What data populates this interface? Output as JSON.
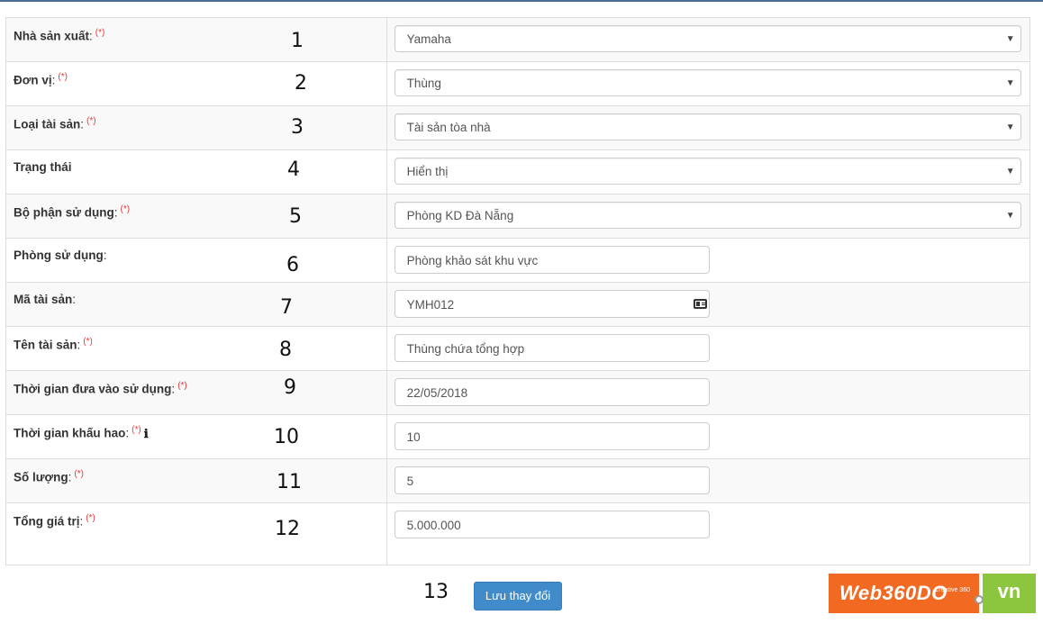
{
  "required_marker": "(*)",
  "fields": [
    {
      "label": "Nhà sản xuất",
      "colon": ":",
      "required": true,
      "number": "1",
      "type": "select",
      "value": "Yamaha"
    },
    {
      "label": "Đơn vị",
      "colon": ":",
      "required": true,
      "number": "2",
      "type": "select",
      "value": "Thùng"
    },
    {
      "label": "Loại tài sản",
      "colon": ":",
      "required": true,
      "number": "3",
      "type": "select",
      "value": "Tài sản tòa nhà"
    },
    {
      "label": "Trạng thái",
      "colon": "",
      "required": false,
      "number": "4",
      "type": "select",
      "value": "Hiển thị"
    },
    {
      "label": "Bộ phận sử dụng",
      "colon": ":",
      "required": true,
      "number": "5",
      "type": "select",
      "value": "Phòng KD Đà Nẵng"
    },
    {
      "label": "Phòng sử dụng",
      "colon": ":",
      "required": false,
      "number": "6",
      "type": "input",
      "value": "Phòng khảo sát khu vực"
    },
    {
      "label": "Mã tài sản",
      "colon": ":",
      "required": false,
      "number": "7",
      "type": "input",
      "value": "YMH012",
      "icon": "id-card-icon"
    },
    {
      "label": "Tên tài sản",
      "colon": ":",
      "required": true,
      "number": "8",
      "type": "input",
      "value": "Thùng chứa tổng hợp"
    },
    {
      "label": "Thời gian đưa vào sử dụng",
      "colon": ":",
      "required": true,
      "number": "9",
      "type": "input",
      "value": "22/05/2018"
    },
    {
      "label": "Thời gian khấu hao",
      "colon": ":",
      "required": true,
      "number": "10",
      "type": "input",
      "value": "10",
      "icon": "info-icon"
    },
    {
      "label": "Số lượng",
      "colon": ":",
      "required": true,
      "number": "11",
      "type": "input",
      "value": "5"
    },
    {
      "label": "Tổng giá trị",
      "colon": ":",
      "required": true,
      "number": "12",
      "type": "input",
      "value": "5.000.000"
    }
  ],
  "info_glyph": "ℹ",
  "select_arrow": "▼",
  "actions": {
    "number": "13",
    "save_label": "Lưu thay đổi"
  },
  "logo": {
    "brand": "Web360DO",
    "suffix": "vn",
    "tagline": "Creative 360"
  },
  "colors": {
    "required": "#e03a3a",
    "button": "#428bca",
    "logo_orange": "#f26a21",
    "logo_green": "#8cc63f"
  }
}
